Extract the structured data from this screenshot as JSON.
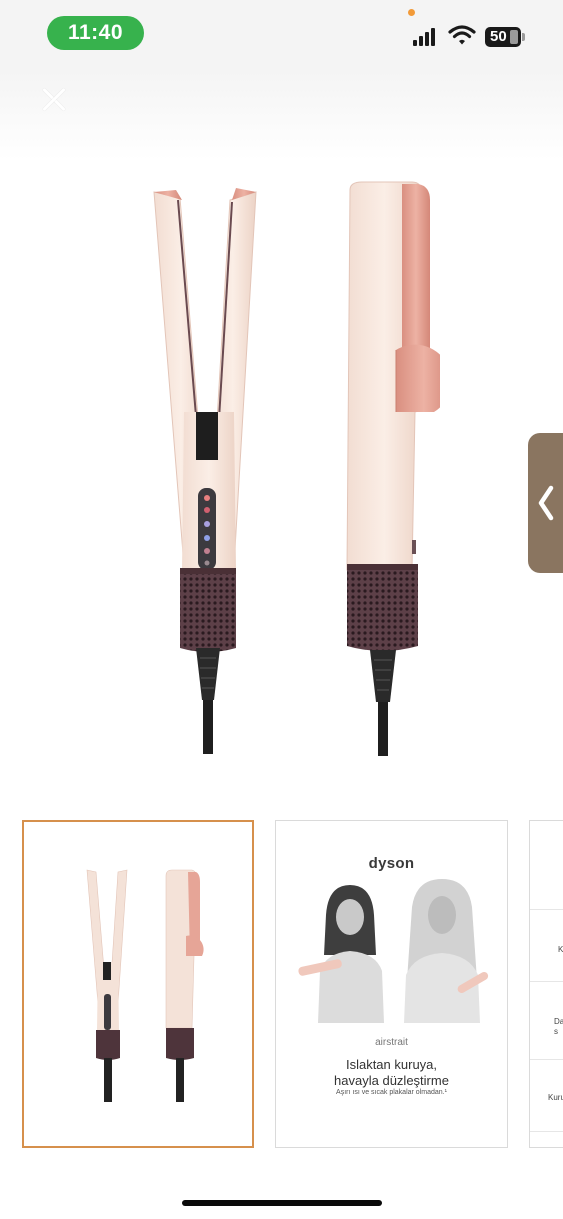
{
  "status_bar": {
    "time": "11:40",
    "battery": "50",
    "colors": {
      "time_pill": "#37b24d",
      "indicator_dot": "#f29a38"
    }
  },
  "icons": {
    "close": "close-icon",
    "signal": "cellular-signal-icon",
    "wifi": "wifi-icon",
    "battery": "battery-icon",
    "chevron": "chevron-left-icon"
  },
  "gallery": {
    "accent_color": "#d6904c",
    "selected_index": 0,
    "thumbnails": [
      {
        "type": "product-photo"
      },
      {
        "type": "brochure",
        "brand": "dyson",
        "product_name": "airstrait",
        "headline_line1": "Islaktan kuruya,",
        "headline_line2": "havayla düzleştirme",
        "subtitle": "Aşırı ısı ve sıcak plakalar olmadan.¹"
      },
      {
        "type": "spec-sheet",
        "row_labels": [
          "K",
          "Da\ns",
          "Kuru"
        ]
      }
    ]
  }
}
